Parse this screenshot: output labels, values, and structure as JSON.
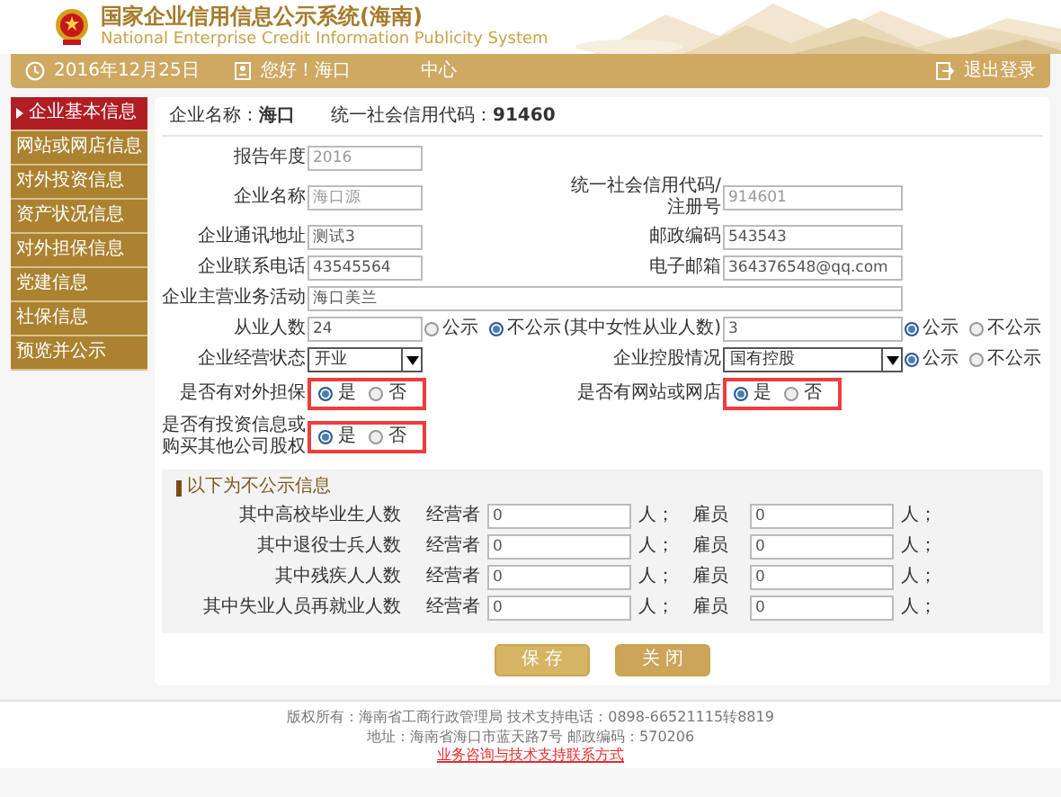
{
  "header": {
    "title": "国家企业信用信息公示系统(海南)",
    "subtitle": "National Enterprise Credit Information Publicity System"
  },
  "topbar": {
    "date": "2016年12月25日",
    "greeting": "您好！海口",
    "greeting_tail": "中心",
    "logout": "退出登录"
  },
  "sidebar": {
    "items": [
      {
        "label": "企业基本信息",
        "selected": true
      },
      {
        "label": "网站或网店信息",
        "selected": false
      },
      {
        "label": "对外投资信息",
        "selected": false
      },
      {
        "label": "资产状况信息",
        "selected": false
      },
      {
        "label": "对外担保信息",
        "selected": false
      },
      {
        "label": "党建信息",
        "selected": false
      },
      {
        "label": "社保信息",
        "selected": false
      },
      {
        "label": "预览并公示",
        "selected": false
      }
    ]
  },
  "company": {
    "name": "企业名称：**海口**",
    "code": "统一社会信用代码：**91460**"
  },
  "form": {
    "rows": [
      [
        {
          "kind": "input",
          "label": "报告年度",
          "value": "2016",
          "readonly": true
        }
      ],
      [
        {
          "kind": "input",
          "label": "企业名称",
          "value": "海口源",
          "readonly": true
        },
        {
          "kind": "input",
          "label": "统一社会信用代码/注册号",
          "value": "914601",
          "readonly": true
        }
      ],
      [
        {
          "kind": "input",
          "label": "企业通讯地址",
          "value": "测试3",
          "readonly": false
        },
        {
          "kind": "input",
          "label": "邮政编码",
          "value": "543543",
          "readonly": false
        }
      ],
      [
        {
          "kind": "input",
          "label": "企业联系电话",
          "value": "43545564",
          "readonly": false
        },
        {
          "kind": "input",
          "label": "电子邮箱",
          "value": "364376548@qq.com",
          "readonly": false
        }
      ],
      [
        {
          "kind": "wide",
          "label": "企业主营业务活动",
          "value": "海口美兰",
          "readonly": false
        }
      ],
      [
        {
          "kind": "input",
          "label": "从业人数",
          "value": "24",
          "readonly": false,
          "options": [
            {
              "label": "公示",
              "selected": false
            },
            {
              "label": "不公示",
              "selected": true
            }
          ]
        },
        {
          "kind": "input",
          "label": "(其中女性从业人数)",
          "value": "3",
          "readonly": false,
          "options": [
            {
              "label": "公示",
              "selected": true
            },
            {
              "label": "不公示",
              "selected": false
            }
          ]
        }
      ],
      [
        {
          "kind": "select",
          "label": "企业经营状态",
          "value": "开业"
        },
        {
          "kind": "select",
          "label": "企业控股情况",
          "value": "国有控股",
          "options": [
            {
              "label": "公示",
              "selected": true
            },
            {
              "label": "不公示",
              "selected": false
            }
          ]
        }
      ],
      [
        {
          "kind": "radio",
          "label": "是否有对外担保",
          "highlighted": true,
          "options": [
            {
              "label": "是",
              "selected": true
            },
            {
              "label": "否",
              "selected": false
            }
          ]
        },
        {
          "kind": "radio",
          "label": "是否有网站或网店",
          "highlighted": true,
          "options": [
            {
              "label": "是",
              "selected": true
            },
            {
              "label": "否",
              "selected": false
            }
          ]
        }
      ],
      [
        {
          "kind": "radio",
          "label": "是否有投资信息或购买其他公司股权",
          "highlighted": true,
          "options": [
            {
              "label": "是",
              "selected": true
            },
            {
              "label": "否",
              "selected": false
            }
          ]
        }
      ]
    ]
  },
  "nonpublic": {
    "title": "以下为不公示信息",
    "rows": [
      {
        "label": "其中高校毕业生人数",
        "owner_label": "经营者",
        "owner_value": "0",
        "owner_unit": "人；",
        "staff_label": "雇员",
        "staff_value": "0",
        "staff_unit": "人；"
      },
      {
        "label": "其中退役士兵人数",
        "owner_label": "经营者",
        "owner_value": "0",
        "owner_unit": "人；",
        "staff_label": "雇员",
        "staff_value": "0",
        "staff_unit": "人；"
      },
      {
        "label": "其中残疾人人数",
        "owner_label": "经营者",
        "owner_value": "0",
        "owner_unit": "人；",
        "staff_label": "雇员",
        "staff_value": "0",
        "staff_unit": "人；"
      },
      {
        "label": "其中失业人员再就业人数",
        "owner_label": "经营者",
        "owner_value": "0",
        "owner_unit": "人；",
        "staff_label": "雇员",
        "staff_value": "0",
        "staff_unit": "人；"
      }
    ]
  },
  "buttons": [
    "保 存",
    "关 闭"
  ],
  "footer": {
    "lines": [
      {
        "text": "版权所有：海南省工商行政管理局 技术支持电话：0898-66521115转8819",
        "kind": "plain"
      },
      {
        "text": "地址：海南省海口市蓝天路7号 邮政编码：570206",
        "kind": "plain"
      },
      {
        "text": "业务咨询与技术支持联系方式",
        "kind": "link"
      }
    ]
  }
}
